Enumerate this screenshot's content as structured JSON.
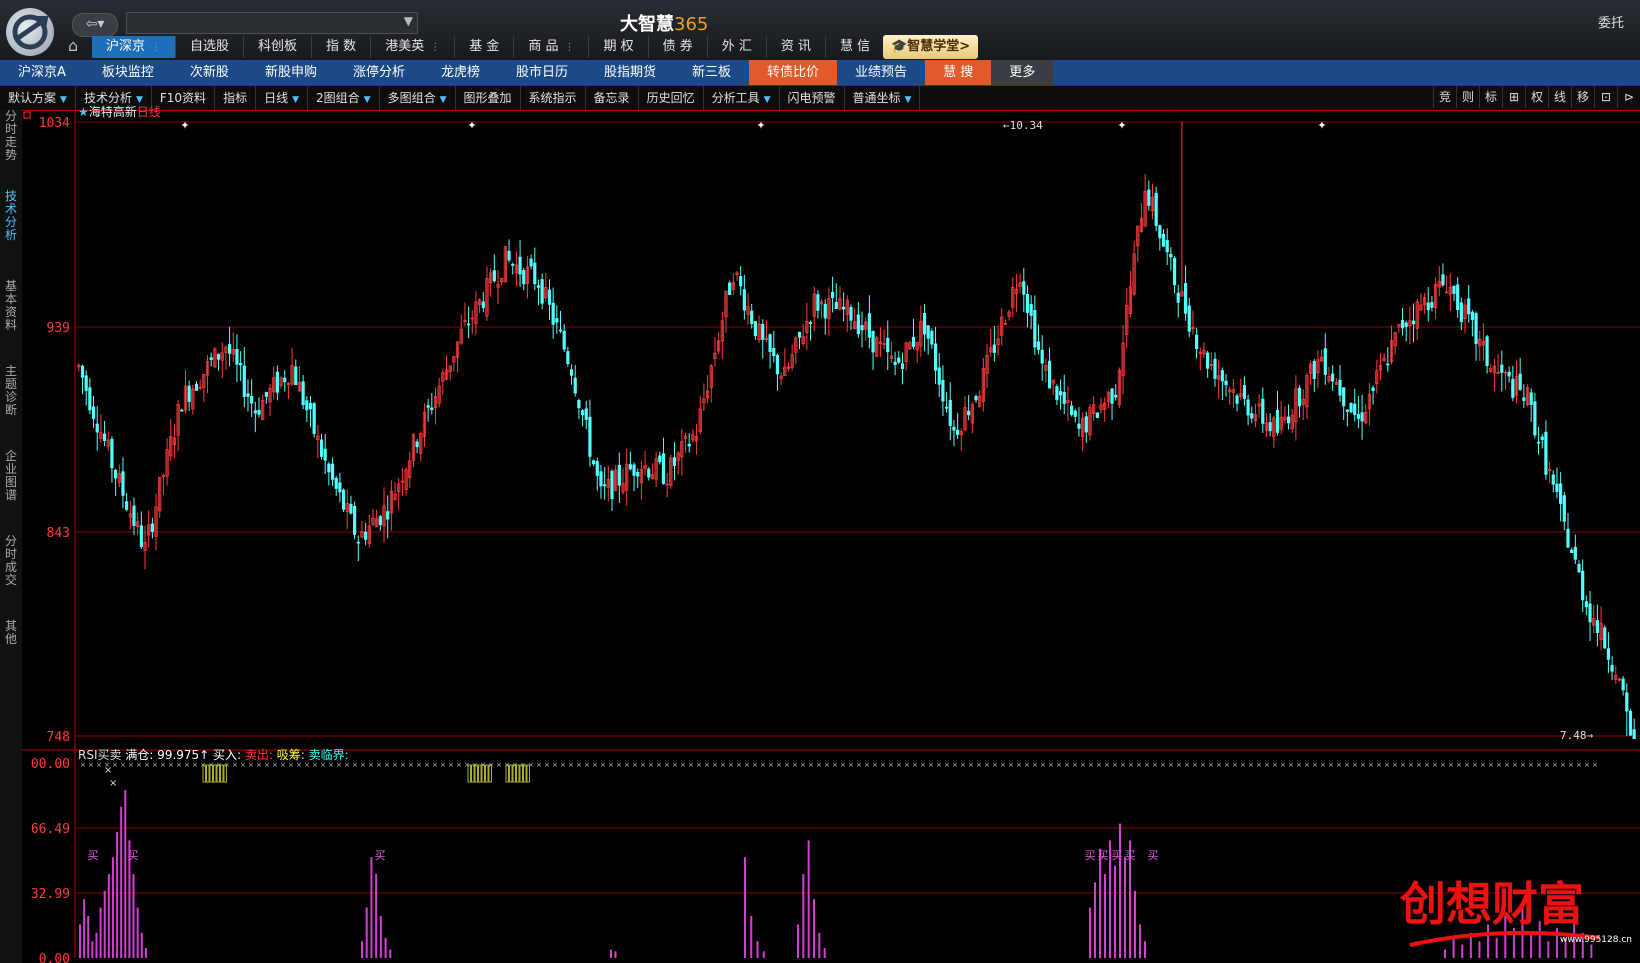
{
  "app": {
    "title": "大智慧",
    "title_num": "365",
    "wt": "委托",
    "academy": "智慧学堂>"
  },
  "topnav": [
    {
      "label": "沪深京",
      "active": true
    },
    {
      "label": "自选股"
    },
    {
      "label": "科创板"
    },
    {
      "label": "指 数"
    },
    {
      "label": "港美英"
    },
    {
      "label": "基 金"
    },
    {
      "label": "商 品"
    },
    {
      "label": "期 权"
    },
    {
      "label": "债 券"
    },
    {
      "label": "外 汇"
    },
    {
      "label": "资 讯"
    },
    {
      "label": "慧 信"
    }
  ],
  "subnav": [
    {
      "label": "沪深京A"
    },
    {
      "label": "板块监控"
    },
    {
      "label": "次新股"
    },
    {
      "label": "新股申购"
    },
    {
      "label": "涨停分析"
    },
    {
      "label": "龙虎榜"
    },
    {
      "label": "股市日历"
    },
    {
      "label": "股指期货"
    },
    {
      "label": "新三板"
    },
    {
      "label": "转债比价",
      "style": "orange"
    },
    {
      "label": "业绩预告"
    },
    {
      "label": "慧 搜",
      "style": "orange"
    },
    {
      "label": "更多",
      "style": "gray"
    }
  ],
  "toolbar": [
    {
      "label": "默认方案",
      "tri": true
    },
    {
      "label": "技术分析",
      "tri": true
    },
    {
      "label": "F10资料"
    },
    {
      "label": "指标"
    },
    {
      "label": "日线",
      "tri": true
    },
    {
      "label": "2图组合",
      "tri": true
    },
    {
      "label": "多图组合",
      "tri": true
    },
    {
      "label": "图形叠加"
    },
    {
      "label": "系统指示"
    },
    {
      "label": "备忘录"
    },
    {
      "label": "历史回忆"
    },
    {
      "label": "分析工具",
      "tri": true
    },
    {
      "label": "闪电预警"
    },
    {
      "label": "普通坐标",
      "tri": true
    }
  ],
  "right_tools": [
    "竞",
    "则",
    "标",
    "⊞",
    "权",
    "线",
    "移",
    "⊡",
    "⊳"
  ],
  "side_tabs": [
    {
      "label": "分时走势"
    },
    {
      "label": "技术分析",
      "active": true
    },
    {
      "label": "基本资料"
    },
    {
      "label": "主题诊断"
    },
    {
      "label": "企业图谱"
    },
    {
      "label": "分时成交"
    },
    {
      "label": "其他"
    }
  ],
  "stock": {
    "name": "海特高新",
    "period": "日线"
  },
  "price_axis": [
    "1034",
    "939",
    "843",
    "748"
  ],
  "price_range": {
    "max": 10.34,
    "min": 7.48
  },
  "ann_max": "10.34",
  "ann_min": "7.48",
  "indicator": {
    "name": "RSI买卖",
    "items": [
      {
        "text": "满仓: 99.975↑",
        "color": "#ffffff"
      },
      {
        "text": "买入:",
        "color": "#ffffff"
      },
      {
        "text": "卖出:",
        "color": "#ff3333"
      },
      {
        "text": "吸筹:",
        "color": "#ffff33"
      },
      {
        "text": "卖临界:",
        "color": "#33ffff"
      }
    ],
    "axis": [
      "00.00",
      "66.49",
      "32.99",
      "0.00"
    ],
    "buy_mark": "买"
  },
  "watermark": {
    "text": "创想财富",
    "url": "www.995128.cn"
  },
  "colors": {
    "up": "#ff3b3b",
    "down": "#54ffff",
    "purple": "#d23fd2",
    "grid": "#8b0000"
  }
}
